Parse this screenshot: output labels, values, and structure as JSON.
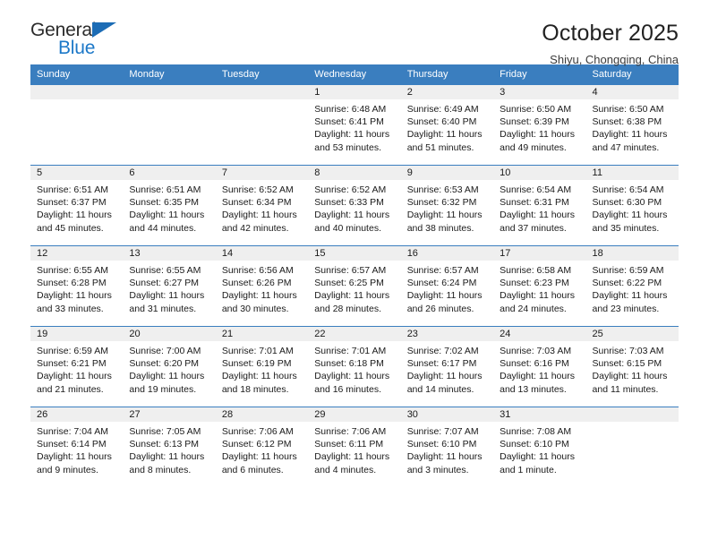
{
  "brand": {
    "general": "General",
    "blue": "Blue",
    "triangle_color": "#1c6cb5",
    "blue_color": "#1c78c8"
  },
  "header": {
    "title": "October 2025",
    "subtitle": "Shiyu, Chongqing, China"
  },
  "theme": {
    "header_bar": "#3a7ebf",
    "daynum_bar": "#efefef",
    "row_divider": "#3a7ebf"
  },
  "weekday_headers": [
    "Sunday",
    "Monday",
    "Tuesday",
    "Wednesday",
    "Thursday",
    "Friday",
    "Saturday"
  ],
  "weeks": [
    [
      {
        "day": "",
        "sunrise": "",
        "sunset": "",
        "daylight_line1": "",
        "daylight_line2": ""
      },
      {
        "day": "",
        "sunrise": "",
        "sunset": "",
        "daylight_line1": "",
        "daylight_line2": ""
      },
      {
        "day": "",
        "sunrise": "",
        "sunset": "",
        "daylight_line1": "",
        "daylight_line2": ""
      },
      {
        "day": "1",
        "sunrise": "Sunrise: 6:48 AM",
        "sunset": "Sunset: 6:41 PM",
        "daylight_line1": "Daylight: 11 hours",
        "daylight_line2": "and 53 minutes."
      },
      {
        "day": "2",
        "sunrise": "Sunrise: 6:49 AM",
        "sunset": "Sunset: 6:40 PM",
        "daylight_line1": "Daylight: 11 hours",
        "daylight_line2": "and 51 minutes."
      },
      {
        "day": "3",
        "sunrise": "Sunrise: 6:50 AM",
        "sunset": "Sunset: 6:39 PM",
        "daylight_line1": "Daylight: 11 hours",
        "daylight_line2": "and 49 minutes."
      },
      {
        "day": "4",
        "sunrise": "Sunrise: 6:50 AM",
        "sunset": "Sunset: 6:38 PM",
        "daylight_line1": "Daylight: 11 hours",
        "daylight_line2": "and 47 minutes."
      }
    ],
    [
      {
        "day": "5",
        "sunrise": "Sunrise: 6:51 AM",
        "sunset": "Sunset: 6:37 PM",
        "daylight_line1": "Daylight: 11 hours",
        "daylight_line2": "and 45 minutes."
      },
      {
        "day": "6",
        "sunrise": "Sunrise: 6:51 AM",
        "sunset": "Sunset: 6:35 PM",
        "daylight_line1": "Daylight: 11 hours",
        "daylight_line2": "and 44 minutes."
      },
      {
        "day": "7",
        "sunrise": "Sunrise: 6:52 AM",
        "sunset": "Sunset: 6:34 PM",
        "daylight_line1": "Daylight: 11 hours",
        "daylight_line2": "and 42 minutes."
      },
      {
        "day": "8",
        "sunrise": "Sunrise: 6:52 AM",
        "sunset": "Sunset: 6:33 PM",
        "daylight_line1": "Daylight: 11 hours",
        "daylight_line2": "and 40 minutes."
      },
      {
        "day": "9",
        "sunrise": "Sunrise: 6:53 AM",
        "sunset": "Sunset: 6:32 PM",
        "daylight_line1": "Daylight: 11 hours",
        "daylight_line2": "and 38 minutes."
      },
      {
        "day": "10",
        "sunrise": "Sunrise: 6:54 AM",
        "sunset": "Sunset: 6:31 PM",
        "daylight_line1": "Daylight: 11 hours",
        "daylight_line2": "and 37 minutes."
      },
      {
        "day": "11",
        "sunrise": "Sunrise: 6:54 AM",
        "sunset": "Sunset: 6:30 PM",
        "daylight_line1": "Daylight: 11 hours",
        "daylight_line2": "and 35 minutes."
      }
    ],
    [
      {
        "day": "12",
        "sunrise": "Sunrise: 6:55 AM",
        "sunset": "Sunset: 6:28 PM",
        "daylight_line1": "Daylight: 11 hours",
        "daylight_line2": "and 33 minutes."
      },
      {
        "day": "13",
        "sunrise": "Sunrise: 6:55 AM",
        "sunset": "Sunset: 6:27 PM",
        "daylight_line1": "Daylight: 11 hours",
        "daylight_line2": "and 31 minutes."
      },
      {
        "day": "14",
        "sunrise": "Sunrise: 6:56 AM",
        "sunset": "Sunset: 6:26 PM",
        "daylight_line1": "Daylight: 11 hours",
        "daylight_line2": "and 30 minutes."
      },
      {
        "day": "15",
        "sunrise": "Sunrise: 6:57 AM",
        "sunset": "Sunset: 6:25 PM",
        "daylight_line1": "Daylight: 11 hours",
        "daylight_line2": "and 28 minutes."
      },
      {
        "day": "16",
        "sunrise": "Sunrise: 6:57 AM",
        "sunset": "Sunset: 6:24 PM",
        "daylight_line1": "Daylight: 11 hours",
        "daylight_line2": "and 26 minutes."
      },
      {
        "day": "17",
        "sunrise": "Sunrise: 6:58 AM",
        "sunset": "Sunset: 6:23 PM",
        "daylight_line1": "Daylight: 11 hours",
        "daylight_line2": "and 24 minutes."
      },
      {
        "day": "18",
        "sunrise": "Sunrise: 6:59 AM",
        "sunset": "Sunset: 6:22 PM",
        "daylight_line1": "Daylight: 11 hours",
        "daylight_line2": "and 23 minutes."
      }
    ],
    [
      {
        "day": "19",
        "sunrise": "Sunrise: 6:59 AM",
        "sunset": "Sunset: 6:21 PM",
        "daylight_line1": "Daylight: 11 hours",
        "daylight_line2": "and 21 minutes."
      },
      {
        "day": "20",
        "sunrise": "Sunrise: 7:00 AM",
        "sunset": "Sunset: 6:20 PM",
        "daylight_line1": "Daylight: 11 hours",
        "daylight_line2": "and 19 minutes."
      },
      {
        "day": "21",
        "sunrise": "Sunrise: 7:01 AM",
        "sunset": "Sunset: 6:19 PM",
        "daylight_line1": "Daylight: 11 hours",
        "daylight_line2": "and 18 minutes."
      },
      {
        "day": "22",
        "sunrise": "Sunrise: 7:01 AM",
        "sunset": "Sunset: 6:18 PM",
        "daylight_line1": "Daylight: 11 hours",
        "daylight_line2": "and 16 minutes."
      },
      {
        "day": "23",
        "sunrise": "Sunrise: 7:02 AM",
        "sunset": "Sunset: 6:17 PM",
        "daylight_line1": "Daylight: 11 hours",
        "daylight_line2": "and 14 minutes."
      },
      {
        "day": "24",
        "sunrise": "Sunrise: 7:03 AM",
        "sunset": "Sunset: 6:16 PM",
        "daylight_line1": "Daylight: 11 hours",
        "daylight_line2": "and 13 minutes."
      },
      {
        "day": "25",
        "sunrise": "Sunrise: 7:03 AM",
        "sunset": "Sunset: 6:15 PM",
        "daylight_line1": "Daylight: 11 hours",
        "daylight_line2": "and 11 minutes."
      }
    ],
    [
      {
        "day": "26",
        "sunrise": "Sunrise: 7:04 AM",
        "sunset": "Sunset: 6:14 PM",
        "daylight_line1": "Daylight: 11 hours",
        "daylight_line2": "and 9 minutes."
      },
      {
        "day": "27",
        "sunrise": "Sunrise: 7:05 AM",
        "sunset": "Sunset: 6:13 PM",
        "daylight_line1": "Daylight: 11 hours",
        "daylight_line2": "and 8 minutes."
      },
      {
        "day": "28",
        "sunrise": "Sunrise: 7:06 AM",
        "sunset": "Sunset: 6:12 PM",
        "daylight_line1": "Daylight: 11 hours",
        "daylight_line2": "and 6 minutes."
      },
      {
        "day": "29",
        "sunrise": "Sunrise: 7:06 AM",
        "sunset": "Sunset: 6:11 PM",
        "daylight_line1": "Daylight: 11 hours",
        "daylight_line2": "and 4 minutes."
      },
      {
        "day": "30",
        "sunrise": "Sunrise: 7:07 AM",
        "sunset": "Sunset: 6:10 PM",
        "daylight_line1": "Daylight: 11 hours",
        "daylight_line2": "and 3 minutes."
      },
      {
        "day": "31",
        "sunrise": "Sunrise: 7:08 AM",
        "sunset": "Sunset: 6:10 PM",
        "daylight_line1": "Daylight: 11 hours",
        "daylight_line2": "and 1 minute."
      },
      {
        "day": "",
        "sunrise": "",
        "sunset": "",
        "daylight_line1": "",
        "daylight_line2": ""
      }
    ]
  ]
}
